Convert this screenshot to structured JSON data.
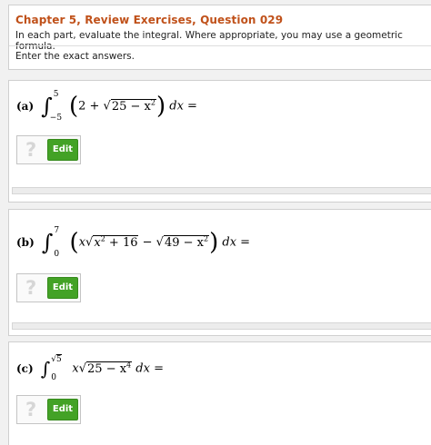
{
  "header": {
    "title": "Chapter 5, Review Exercises, Question 029",
    "instruction": "In each part, evaluate the integral. Where appropriate, you may use a geometric formula.",
    "enter_exact": "Enter the exact answers."
  },
  "parts": [
    {
      "label": "(a)",
      "upper": "5",
      "lower": "−5",
      "lead": "2 + ",
      "radicand": "25 − x",
      "radicand_exp": "2",
      "tail": "dx =",
      "help_icon": "?",
      "edit_label": "Edit"
    },
    {
      "label": "(b)",
      "upper": "7",
      "lower": "0",
      "lead": "x",
      "radicand1": "x",
      "radicand1_exp": "2",
      "radicand1_tail": " + 16",
      "minus": " − ",
      "radicand2": "49 − x",
      "radicand2_exp": "2",
      "tail": "dx =",
      "help_icon": "?",
      "edit_label": "Edit"
    },
    {
      "label": "(c)",
      "upper_root": "5",
      "lower": "0",
      "lead": "x",
      "radicand": "25 − x",
      "radicand_exp": "4",
      "tail": "dx =",
      "help_icon": "?",
      "edit_label": "Edit"
    }
  ],
  "colors": {
    "title": "#c0511a",
    "edit_button": "#43a226",
    "help_icon": "#d6d6d6"
  }
}
